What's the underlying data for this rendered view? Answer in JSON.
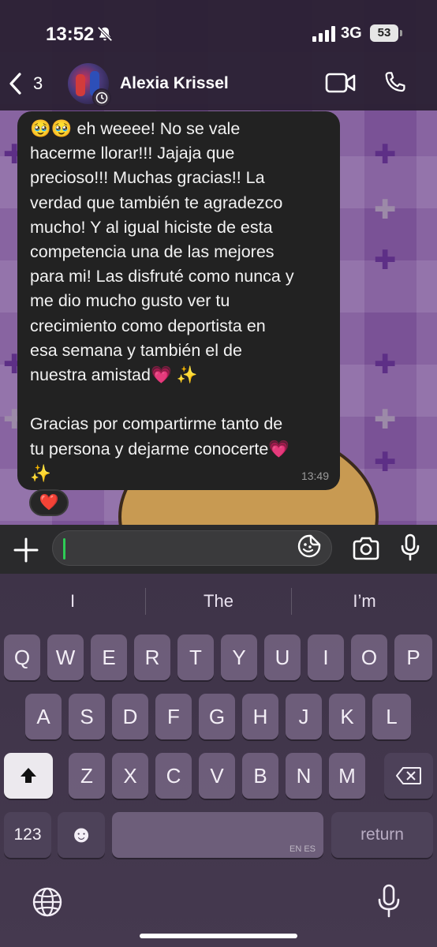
{
  "status_bar": {
    "time": "13:52",
    "network": "3G",
    "battery": "53"
  },
  "header": {
    "back_count": "3",
    "contact_name": "Alexia Krissel"
  },
  "message": {
    "text": "🥹🥹 eh weeee! No se vale\nhacerme llorar!!! Jajaja que\nprecioso!!! Muchas gracias!! La\nverdad que también te agradezco\nmucho! Y al igual hiciste de esta\ncompetencia una de las mejores\npara mi! Las disfruté como nunca y\nme dio mucho gusto ver tu\ncrecimiento como deportista en\nesa semana y también el de\nnuestra amistad💗 ✨\n\nGracias por compartirme tanto de\ntu persona y dejarme conocerte💗\n✨",
    "time": "13:49",
    "reaction": "❤️"
  },
  "compose": {
    "placeholder": ""
  },
  "keyboard": {
    "suggestions": [
      "I",
      "The",
      "I’m"
    ],
    "row1": [
      "Q",
      "W",
      "E",
      "R",
      "T",
      "Y",
      "U",
      "I",
      "O",
      "P"
    ],
    "row2": [
      "A",
      "S",
      "D",
      "F",
      "G",
      "H",
      "J",
      "K",
      "L"
    ],
    "row3": [
      "Z",
      "X",
      "C",
      "V",
      "B",
      "N",
      "M"
    ],
    "numbers_label": "123",
    "emoji_glyph": "☻",
    "space_lang": "EN ES",
    "return_label": "return"
  },
  "colors": {
    "accent_caret": "#2ecc55",
    "bubble": "#222222",
    "wallpaper": "#7a5296"
  }
}
